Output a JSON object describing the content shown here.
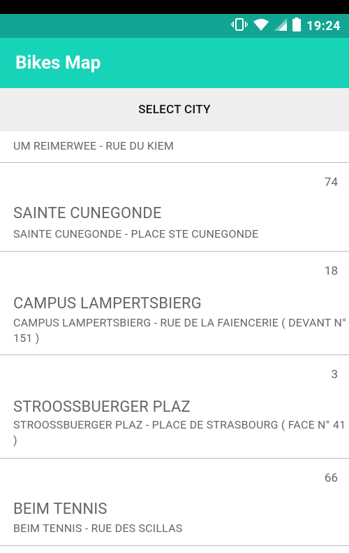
{
  "status": {
    "time": "19:24"
  },
  "app": {
    "title": "Bikes Map"
  },
  "select_city": {
    "label": "SELECT CITY"
  },
  "partial_item": {
    "subtitle": "UM REIMERWEE - RUE DU KIEM"
  },
  "stations": [
    {
      "count": "74",
      "name": "SAINTE CUNEGONDE",
      "address": "SAINTE CUNEGONDE - PLACE STE CUNEGONDE"
    },
    {
      "count": "18",
      "name": "CAMPUS LAMPERTSBIERG",
      "address": "CAMPUS LAMPERTSBIERG - RUE DE LA FAIENCERIE ( DEVANT N° 151 )"
    },
    {
      "count": "3",
      "name": "STROOSSBUERGER PLAZ",
      "address": "STROOSSBUERGER PLAZ - PLACE DE STRASBOURG ( FACE N° 41 )"
    },
    {
      "count": "66",
      "name": "BEIM TENNIS",
      "address": "BEIM TENNIS - RUE DES SCILLAS"
    }
  ]
}
